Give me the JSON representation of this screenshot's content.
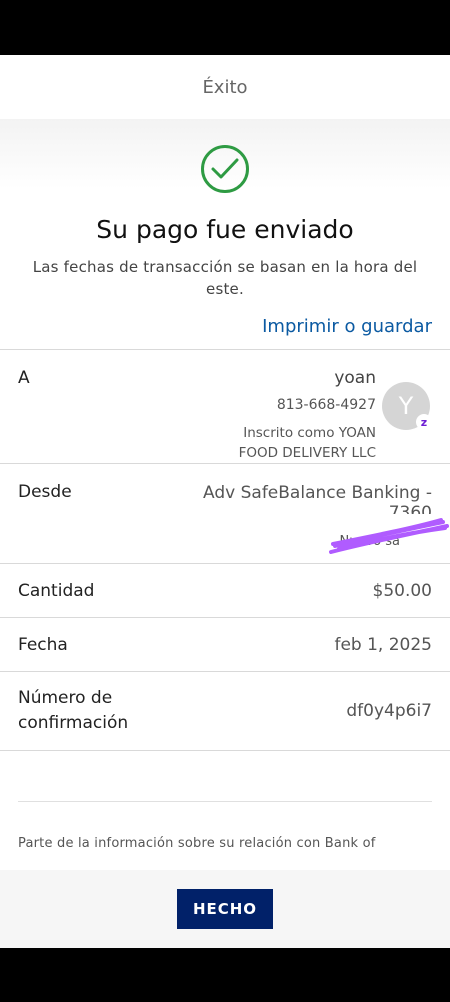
{
  "header": {
    "title": "Éxito"
  },
  "confirmation": {
    "title": "Su pago fue enviado",
    "subtitle": "Las fechas de transacción se basan en la hora del este.",
    "print_link": "Imprimir o guardar"
  },
  "details": {
    "to": {
      "label": "A",
      "name": "yoan",
      "phone": "813-668-4927",
      "enrolled_line1": "Inscrito como YOAN",
      "enrolled_line2": "FOOD DELIVERY LLC",
      "avatar_letter": "Y",
      "badge_letter": "z"
    },
    "from": {
      "label": "Desde",
      "account": "Adv SafeBalance Banking -",
      "account_suffix": "7360",
      "new_balance_label": "Nuevo sa"
    },
    "amount": {
      "label": "Cantidad",
      "value": "$50.00"
    },
    "date": {
      "label": "Fecha",
      "value": "feb 1, 2025"
    },
    "confirmation_number": {
      "label_line1": "Número de",
      "label_line2": "confirmación",
      "value": "df0y4p6i7"
    }
  },
  "footnote": "Parte de la información sobre su relación con Bank of",
  "done_button": "HECHO",
  "colors": {
    "success": "#2e9b43",
    "link": "#0b5aa2",
    "button": "#012169",
    "redaction": "#b05cff",
    "zelle": "#6d1ed4"
  },
  "icons": {
    "success": "check-circle-icon",
    "avatar": "avatar",
    "badge": "zelle-icon"
  }
}
